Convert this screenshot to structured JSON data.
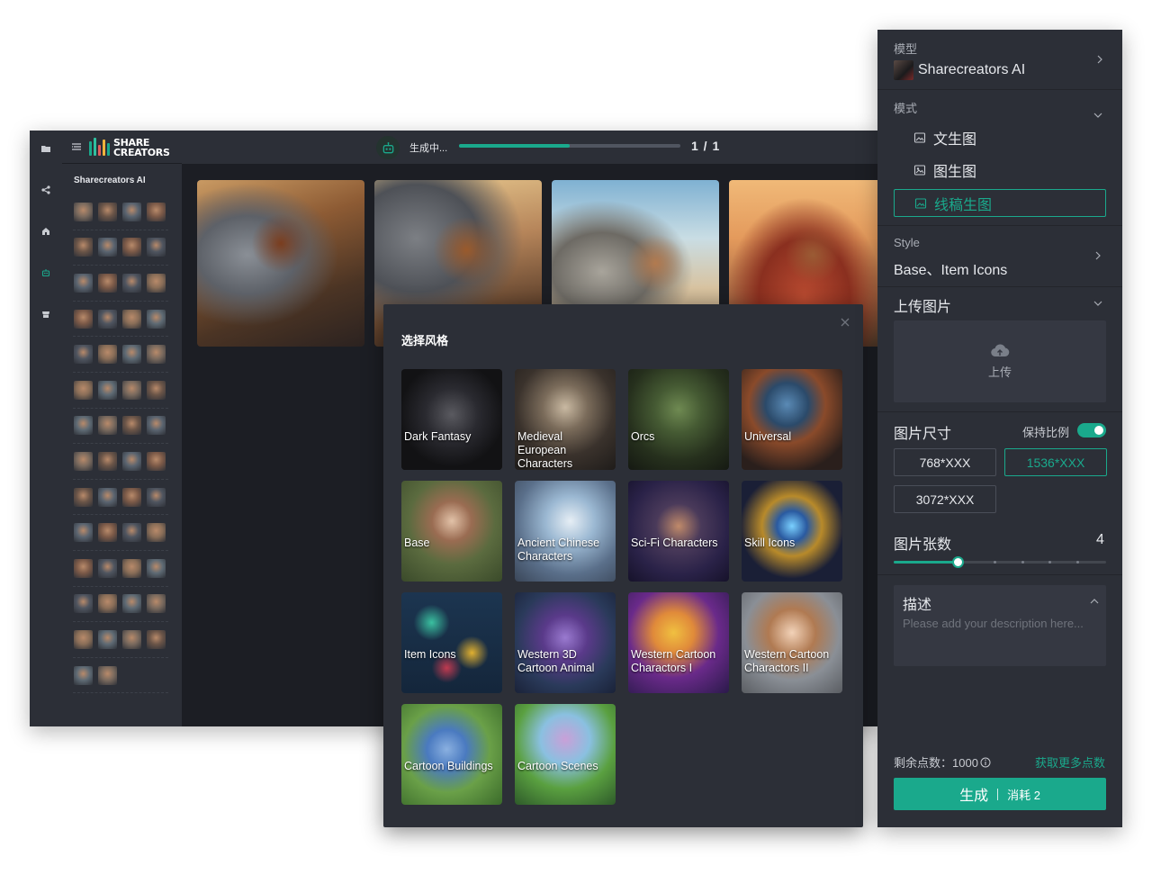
{
  "app": {
    "rail_icons": [
      "folder-icon",
      "share-icon",
      "home-icon",
      "robot-icon",
      "store-icon"
    ],
    "logo_line1": "SHARE",
    "logo_line2": "CREATORS",
    "history_title": "Sharecreators AI",
    "generating_label": "生成中...",
    "progress": 0.5,
    "page_count": "1 / 1"
  },
  "modal": {
    "title": "选择风格",
    "styles": [
      {
        "label": "Dark Fantasy"
      },
      {
        "label": "Medieval European Characters"
      },
      {
        "label": "Orcs"
      },
      {
        "label": "Universal"
      },
      {
        "label": "Base"
      },
      {
        "label": "Ancient Chinese Characters"
      },
      {
        "label": "Sci-Fi Characters"
      },
      {
        "label": "Skill Icons"
      },
      {
        "label": "Item Icons"
      },
      {
        "label": "Western 3D Cartoon Animal"
      },
      {
        "label": "Western Cartoon Charactors I"
      },
      {
        "label": "Western Cartoon Charactors II"
      },
      {
        "label": "Cartoon Buildings"
      },
      {
        "label": "Cartoon Scenes"
      }
    ]
  },
  "panel": {
    "model_label": "模型",
    "model_value": "Sharecreators AI",
    "mode_label": "模式",
    "modes": [
      "文生图",
      "图生图"
    ],
    "mode_active": "线稿生图",
    "style_label": "Style",
    "style_value": "Base、Item Icons",
    "upload_label": "上传图片",
    "upload_button": "上传",
    "size_label": "图片尺寸",
    "keep_ratio_label": "保持比例",
    "keep_ratio_on": true,
    "sizes": [
      "768*XXX",
      "1536*XXX",
      "3072*XXX"
    ],
    "size_selected": "1536*XXX",
    "count_label": "图片张数",
    "count_value": "4",
    "count_fraction": 0.3,
    "desc_title": "描述",
    "desc_placeholder": "Please add your description here...",
    "points_text": "剩余点数：1000",
    "more_points": "获取更多点数",
    "generate_label": "生成",
    "generate_cost": "消耗 2"
  },
  "colors": {
    "accent": "#1aa98c",
    "panel_bg": "#2c2f37",
    "app_bg": "#1c1e24"
  }
}
